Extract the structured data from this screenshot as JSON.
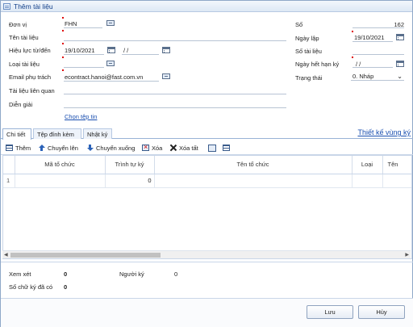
{
  "window": {
    "title": "Thêm tài liệu"
  },
  "form": {
    "left": [
      {
        "label": "Đơn vị",
        "value": "FHN"
      },
      {
        "label": "Tên tài liệu",
        "value": ""
      },
      {
        "label": "Hiệu lực từ/đến",
        "from": "19/10/2021",
        "to": " /  /"
      },
      {
        "label": "Loại tài liệu",
        "value": ""
      },
      {
        "label": "Email phụ trách",
        "value": "econtract.hanoi@fast.com.vn"
      },
      {
        "label": "Tài liệu liên quan",
        "value": ""
      },
      {
        "label": "Diễn giải",
        "value": ""
      }
    ],
    "choose_file_link": "Chọn tệp tin",
    "right": {
      "so_label": "Số",
      "so_value": "162",
      "ngay_lap_label": "Ngày lập",
      "ngay_lap_value": "19/10/2021",
      "so_tai_lieu_label": "Số tài liệu",
      "so_tai_lieu_value": "",
      "ngay_het_han_label": "Ngày hết hạn ký",
      "ngay_het_han_value": " /  /",
      "trang_thai_label": "Trạng thái",
      "trang_thai_value": "0. Nháp"
    }
  },
  "tabs": [
    {
      "label": "Chi tiết"
    },
    {
      "label": "Tệp đính kèm"
    },
    {
      "label": "Nhật ký"
    }
  ],
  "design_link": "Thiết kế vùng ký",
  "toolbar": {
    "add": "Thêm",
    "move_up": "Chuyển lên",
    "move_down": "Chuyển xuống",
    "delete": "Xóa",
    "delete_all": "Xóa tất"
  },
  "table": {
    "columns": [
      "",
      "Mã tổ chức",
      "Trình tự ký",
      "Tên tổ chức",
      "Loại",
      "Tên"
    ],
    "rows": [
      {
        "num": "1",
        "ma": "",
        "trinh_tu": "0",
        "ten": "",
        "loai": "",
        "ten2": ""
      }
    ]
  },
  "footer": {
    "xem_xet_label": "Xem xét",
    "xem_xet_value": "0",
    "nguoi_ky_label": "Người ký",
    "nguoi_ky_value": "0",
    "so_chu_ky_label": "Số chữ ký đã có",
    "so_chu_ky_value": "0"
  },
  "buttons": {
    "save": "Lưu",
    "cancel": "Hủy"
  }
}
